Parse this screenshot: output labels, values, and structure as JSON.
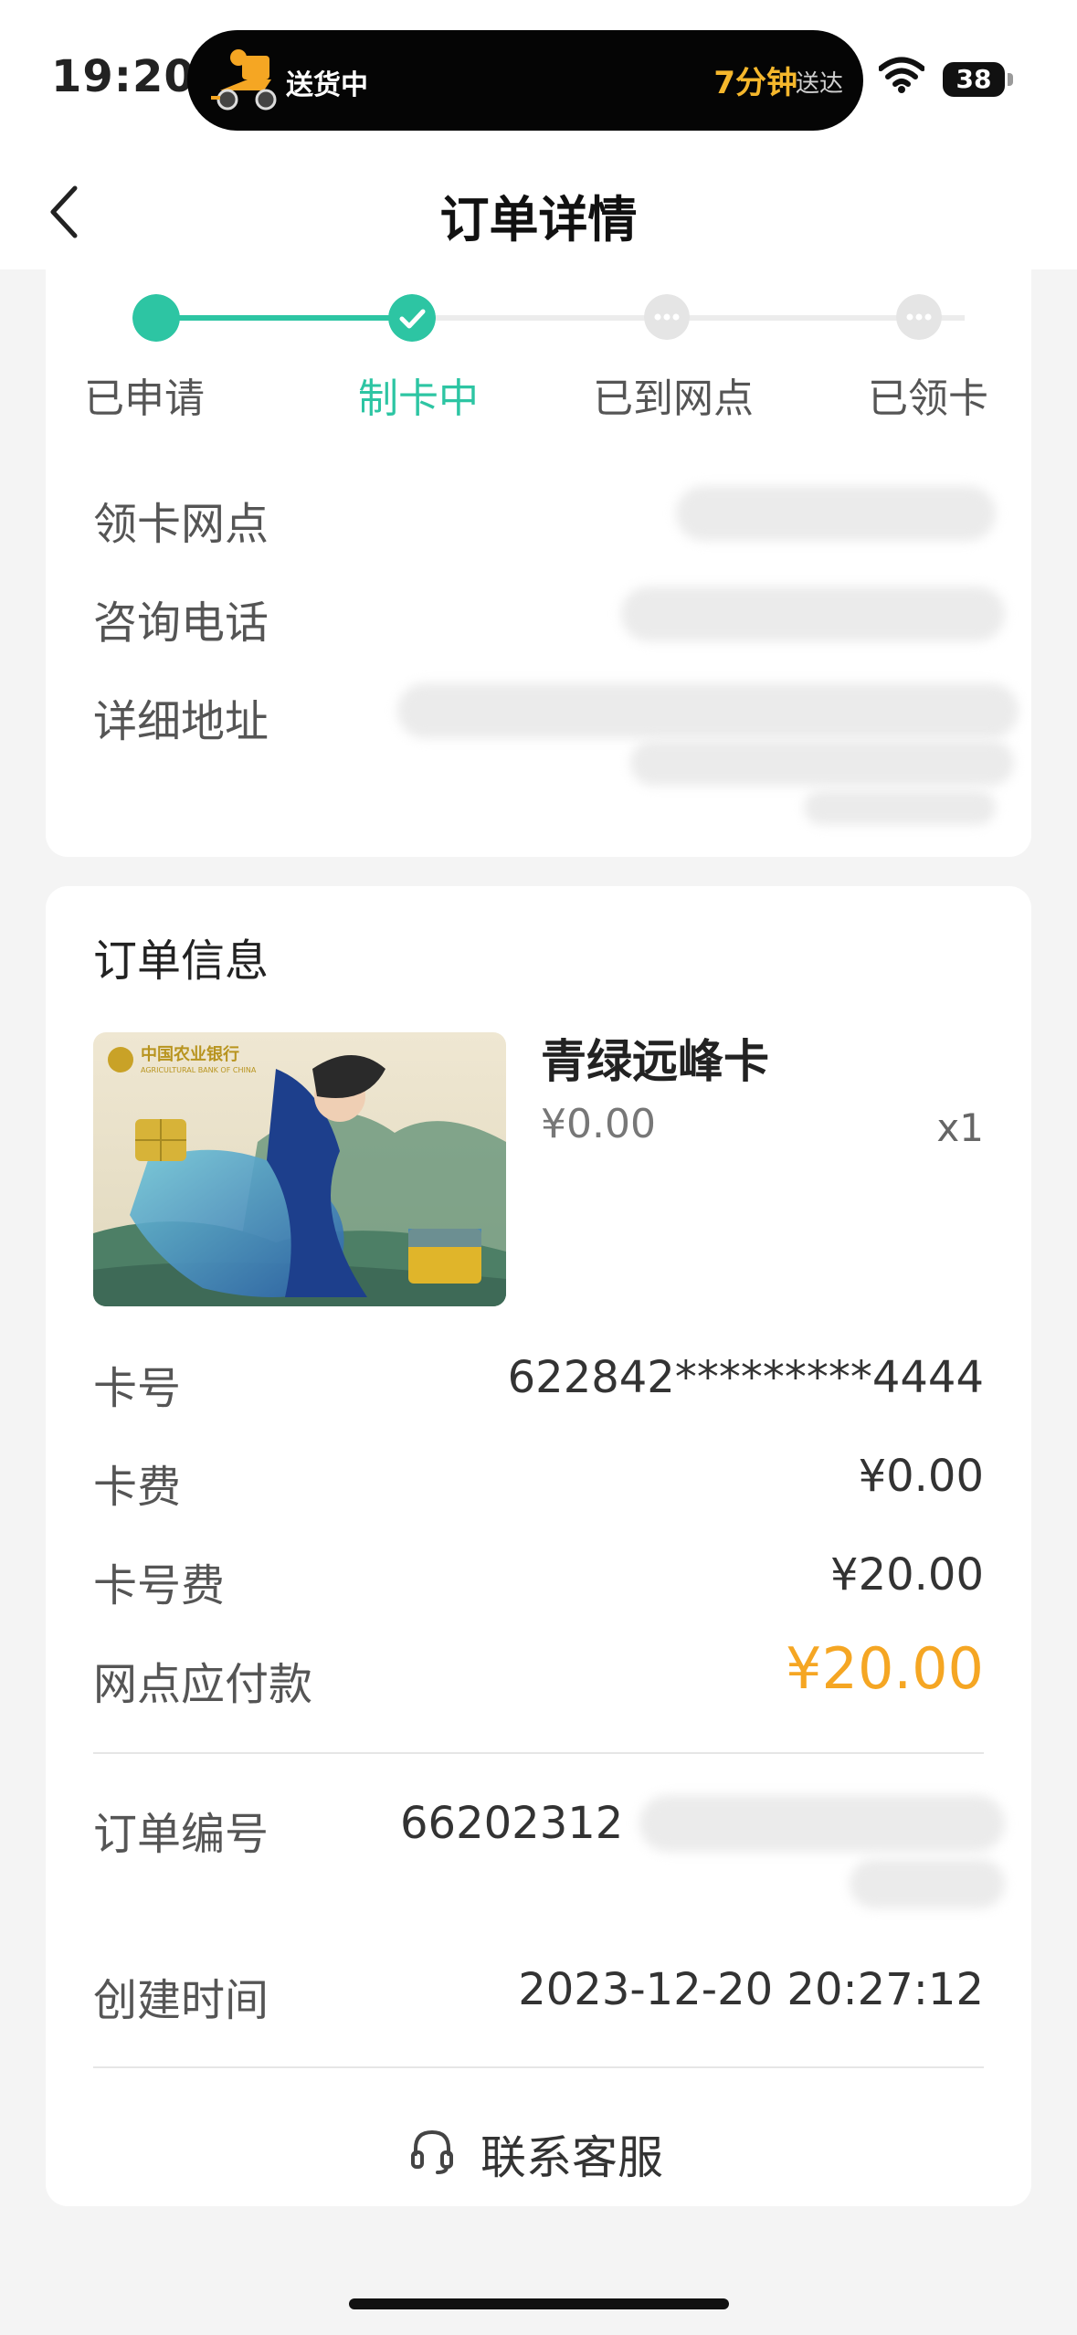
{
  "status_bar": {
    "time": "19:20",
    "activity": {
      "text": "送货中",
      "eta": "7分钟",
      "eta_suffix": "送达"
    },
    "battery": "38"
  },
  "nav": {
    "title": "订单详情",
    "back_icon": "chevron-left-icon"
  },
  "progress": {
    "accent_color": "#2dc5a3",
    "steps": [
      {
        "label": "已申请",
        "state": "done"
      },
      {
        "label": "制卡中",
        "state": "current"
      },
      {
        "label": "已到网点",
        "state": "pending"
      },
      {
        "label": "已领卡",
        "state": "pending"
      }
    ]
  },
  "branch_info": {
    "labels": [
      "领卡网点",
      "咨询电话",
      "详细地址"
    ]
  },
  "order": {
    "section_title": "订单信息",
    "product": {
      "name": "青绿远峰卡",
      "price": "¥0.00",
      "qty": "x1"
    },
    "card_bank": {
      "cn": "中国农业银行",
      "en": "AGRICULTURAL BANK OF CHINA"
    },
    "rows": [
      {
        "label": "卡号",
        "value": "622842*********4444"
      },
      {
        "label": "卡费",
        "value": "¥0.00"
      },
      {
        "label": "卡号费",
        "value": "¥20.00"
      },
      {
        "label": "网点应付款",
        "value": "¥20.00"
      }
    ],
    "order_no": {
      "label": "订单编号",
      "value_prefix": "66202312"
    },
    "created": {
      "label": "创建时间",
      "value": "2023-12-20 20:27:12"
    },
    "highlight_color": "#f5a623"
  },
  "footer": {
    "contact_label": "联系客服",
    "icon": "headset-icon"
  }
}
